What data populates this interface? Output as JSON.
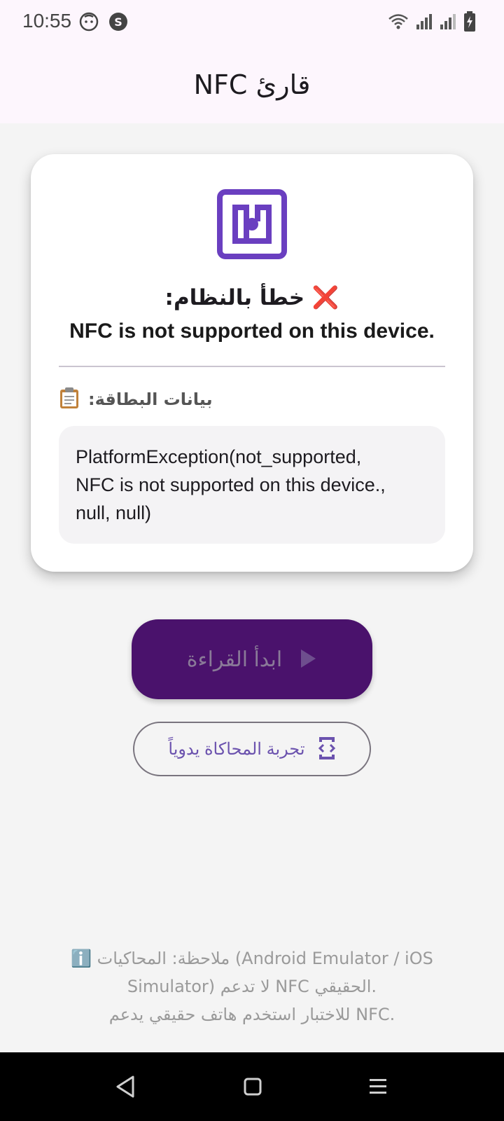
{
  "status": {
    "time": "10:55",
    "icons": [
      "face-icon",
      "s-app-icon",
      "wifi-icon",
      "signal-icon",
      "signal-2-icon",
      "battery-charging-icon"
    ]
  },
  "app_bar": {
    "title": "قارئ NFC"
  },
  "card": {
    "icon": "nfc-icon",
    "error_title": "❌ خطأ بالنظام:",
    "error_message": "NFC is not supported on this device.",
    "data_label": "بيانات البطاقة:",
    "data_icon": "clipboard-icon",
    "data_lines": [
      "PlatformException(not_supported,",
      "NFC is not supported on this device.,",
      "null, null)"
    ]
  },
  "buttons": {
    "start_label": "ابدأ القراءة",
    "start_icon": "play-icon",
    "simulate_label": "تجربة المحاكاة يدوياً",
    "simulate_icon": "code-phone-icon"
  },
  "note": {
    "lines": [
      "ℹ️ ملاحظة: المحاكيات (Android Emulator / iOS",
      "Simulator) لا تدعم NFC الحقيقي.",
      "للاختبار استخدم هاتف حقيقي يدعم NFC."
    ]
  },
  "colors": {
    "accent": "#6a3fc0",
    "button_bg": "#4a126c",
    "app_bar_bg": "#fdf6fd",
    "page_bg": "#f4f4f4"
  }
}
